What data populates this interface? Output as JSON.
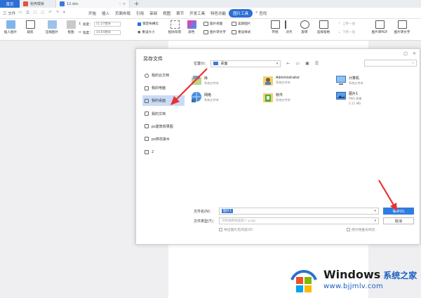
{
  "titlebar": {
    "home_tab": "首页",
    "tabs": [
      {
        "label": "稻壳模板",
        "icon": "daoke-icon",
        "color": "#e0533f"
      },
      {
        "label": "12.doc",
        "icon": "word-doc-icon",
        "color": "#3a7bd5"
      }
    ],
    "new_tab": "+"
  },
  "menu": {
    "file": "三 文件",
    "items": [
      "开始",
      "插入",
      "页面布局",
      "引用",
      "审阅",
      "视图",
      "章节",
      "开发工具",
      "特色功能",
      "图片工具"
    ],
    "active": "图片工具",
    "search": "查找"
  },
  "ribbon": {
    "insert_image": "插入图片",
    "crop": "裁剪",
    "compress": "压缩图片",
    "clear": "抠图",
    "height_label": "高度：",
    "height_value": "11.27厘米",
    "width_label": "宽度：",
    "width_value": "14.64厘米",
    "lock_ratio": "锁定纵横比",
    "reset_size": "重设大小",
    "smart_cutout": "抠除背景",
    "image_split": "图片拆图",
    "image_beautify": "美颜图片",
    "image_to_text": "图片转文字",
    "color": "颜色",
    "effects": "效果",
    "border": "边框",
    "reset": "重设样式",
    "wrap": "环绕",
    "align": "对齐",
    "rotate": "旋转",
    "select_pane": "选择窗格",
    "move_up": "上移一层",
    "move_down": "下移一层",
    "combine": "组合",
    "to_pdf": "图片转PDF",
    "translate": "图片转文字",
    "print": "图片打印"
  },
  "dialog": {
    "title": "另存文件",
    "sidebar": [
      {
        "label": "我的云文档",
        "icon": "cloud-icon"
      },
      {
        "label": "我的电脑",
        "icon": "computer-icon"
      },
      {
        "label": "我的桌面",
        "icon": "desktop-icon",
        "active": true
      },
      {
        "label": "我的文档",
        "icon": "documents-icon"
      },
      {
        "label": "ps建筑效果图",
        "icon": "folder-icon"
      },
      {
        "label": "ps棉花接木",
        "icon": "folder-icon"
      },
      {
        "label": "2",
        "icon": "folder-icon"
      }
    ],
    "path_label": "位置(I)：",
    "path_value": "桌面",
    "files": [
      {
        "name": "库",
        "sub": "系统文件夹",
        "icon": "library-icon"
      },
      {
        "name": "Administrator",
        "sub": "系统文件夹",
        "icon": "user-folder-icon"
      },
      {
        "name": "计算机",
        "sub": "系统文件夹",
        "icon": "computer-icon"
      },
      {
        "name": "网络",
        "sub": "系统文件夹",
        "icon": "network-icon"
      },
      {
        "name": "软件",
        "sub": "系统文件夹",
        "icon": "software-folder-icon"
      },
      {
        "name": "图片1",
        "sub": "PNG 图像",
        "sub2": "3.12 MB",
        "icon": "png-image-icon"
      }
    ],
    "filename_label": "文件名(N)：",
    "filename_value": "图片1",
    "filetype_label": "文件类型(T)：",
    "filetype_value": "可移植网络图形(*.png)",
    "save_button": "保存(S)",
    "cancel_button": "取消",
    "export_option": "导出图片后浏览(O)",
    "encrypt_option": "把文档备份到云"
  },
  "watermark": {
    "brand": "Windows",
    "cn": "系统之家",
    "url": "www.bjjmlv.com"
  },
  "colors": {
    "accent": "#2b6fd6",
    "primary_button": "#2f7de1",
    "selection": "#c9dcf7",
    "arrow": "#e8312f"
  }
}
